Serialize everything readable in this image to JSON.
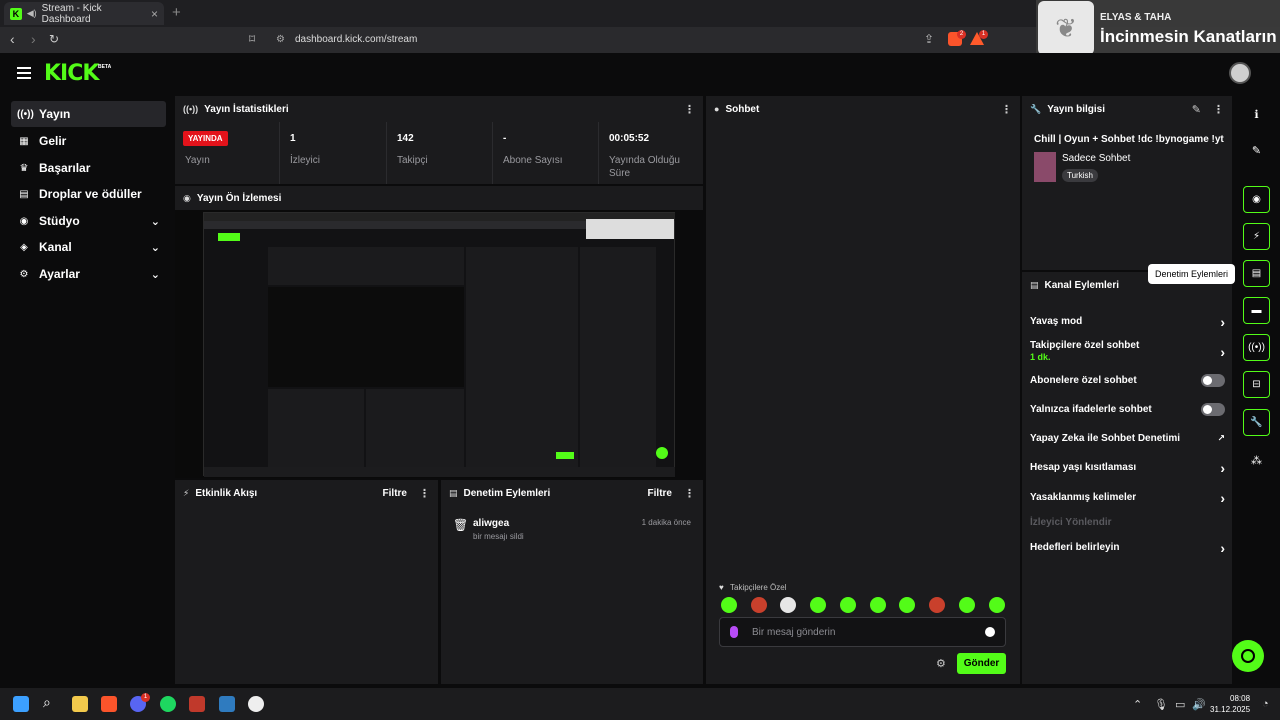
{
  "browser": {
    "tab_title": "Stream - Kick Dashboard",
    "url": "dashboard.kick.com/stream",
    "brave_badge": "2",
    "rewards_badge": "1"
  },
  "overlay": {
    "line1": "ELYAS & TAHA",
    "line2": "İncinmesin Kanatların"
  },
  "header": {
    "logo": "KICK",
    "beta": "BETA"
  },
  "sidebar": {
    "items": [
      {
        "label": "Yayın",
        "icon": "broadcast-icon"
      },
      {
        "label": "Gelir",
        "icon": "revenue-icon"
      },
      {
        "label": "Başarılar",
        "icon": "trophy-icon"
      },
      {
        "label": "Droplar ve ödüller",
        "icon": "drops-icon"
      },
      {
        "label": "Stüdyo",
        "icon": "studio-icon"
      },
      {
        "label": "Kanal",
        "icon": "channel-icon"
      },
      {
        "label": "Ayarlar",
        "icon": "gear-icon"
      }
    ]
  },
  "stats": {
    "title": "Yayın İstatistikleri",
    "live_badge": "YAYINDA",
    "live_label": "Yayın",
    "viewers_value": "1",
    "viewers_label": "İzleyici",
    "followers_value": "142",
    "followers_label": "Takipçi",
    "subs_value": "-",
    "subs_label": "Abone Sayısı",
    "uptime_value": "00:05:52",
    "uptime_label": "Yayında Olduğu Süre"
  },
  "preview": {
    "title": "Yayın Ön İzlemesi"
  },
  "activity": {
    "title": "Etkinlik Akışı",
    "filter": "Filtre"
  },
  "moderation": {
    "title": "Denetim Eylemleri",
    "filter": "Filtre",
    "entry_user": "aliwgea",
    "entry_action": "bir mesajı sildi",
    "entry_time": "1 dakika önce"
  },
  "chat": {
    "title": "Sohbet",
    "followers_only": "Takipçilere Özel",
    "placeholder": "Bir mesaj gönderin",
    "send": "Gönder"
  },
  "stream_info": {
    "title": "Yayın bilgisi",
    "stream_title": "Chill | Oyun + Sohbet !dc !bynogame !yt",
    "category": "Sadece Sohbet",
    "tag": "Turkish"
  },
  "channel_actions": {
    "title": "Kanal Eylemleri",
    "slow_mode": "Yavaş mod",
    "followers_chat": "Takipçilere özel sohbet",
    "followers_chat_value": "1 dk.",
    "subs_chat": "Abonelere özel sohbet",
    "emotes_chat": "Yalnızca ifadelerle sohbet",
    "ai_moderation": "Yapay Zeka ile Sohbet Denetimi",
    "account_age": "Hesap yaşı kısıtlaması",
    "banned_words": "Yasaklanmış kelimeler",
    "redirect": "İzleyici Yönlendir",
    "goals": "Hedefleri belirleyin"
  },
  "rail": {
    "tooltip": "Denetim Eylemleri"
  },
  "taskbar": {
    "time": "08:08",
    "date": "31.12.2025",
    "discord_badge": "1"
  }
}
